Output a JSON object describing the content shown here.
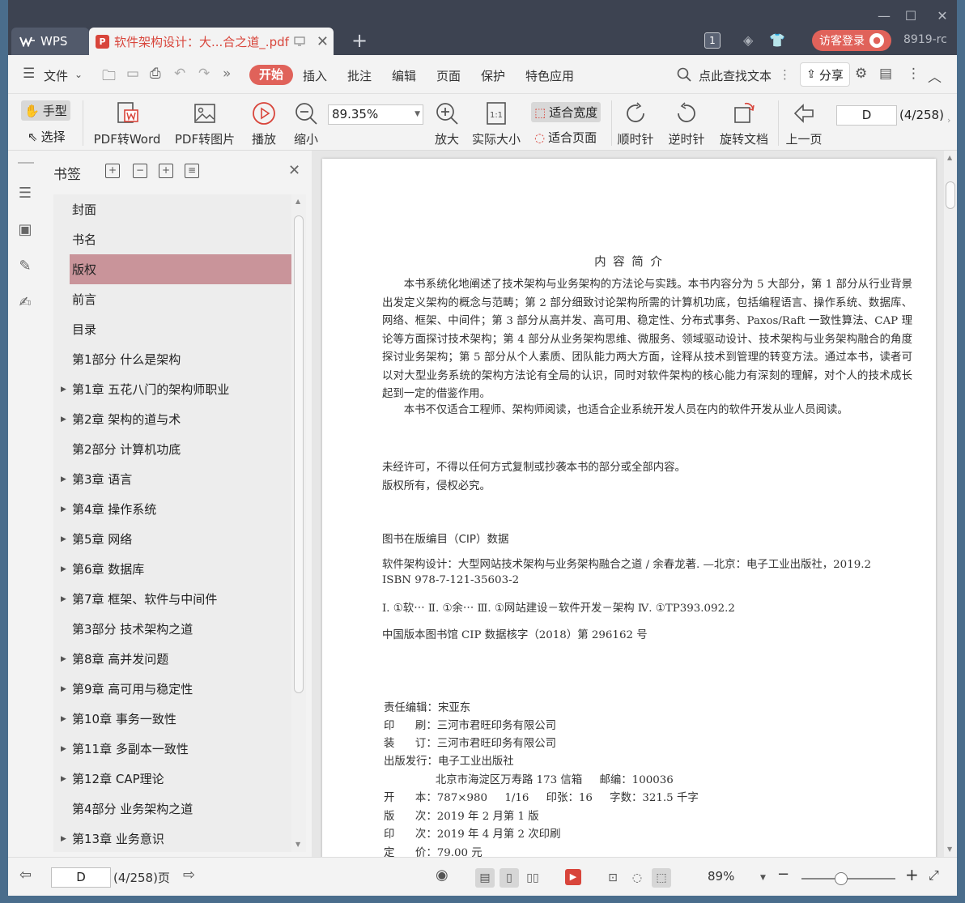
{
  "window": {
    "controls": [
      "—",
      "☐",
      "✕"
    ]
  },
  "tabs": {
    "home_label": "WPS",
    "doc_title": "软件架构设计：大...合之道_.pdf",
    "doc_badge": "1",
    "login_label": "访客登录",
    "user_name": "8919-rc"
  },
  "menu": {
    "file": "文件",
    "start": "开始",
    "insert": "插入",
    "annotate": "批注",
    "edit": "编辑",
    "page": "页面",
    "protect": "保护",
    "features": "特色应用",
    "search_hint": "点此查找文本",
    "share": "分享"
  },
  "ribbon": {
    "hand": "手型",
    "select": "选择",
    "pdf_to_word": "PDF转Word",
    "pdf_to_image": "PDF转图片",
    "play": "播放",
    "zoom_out": "缩小",
    "zoom_value": "89.35%",
    "zoom_in": "放大",
    "actual_size": "实际大小",
    "fit_width": "适合宽度",
    "fit_page": "适合页面",
    "rotate_cw": "顺时针",
    "rotate_ccw": "逆时针",
    "rotate_doc": "旋转文档",
    "prev_page": "上一页",
    "page_input": "D",
    "page_count": "(4/258)"
  },
  "bookmarks": {
    "title": "书签",
    "items": [
      {
        "label": "封面",
        "expandable": false,
        "selected": false
      },
      {
        "label": "书名",
        "expandable": false,
        "selected": false
      },
      {
        "label": "版权",
        "expandable": false,
        "selected": true
      },
      {
        "label": "前言",
        "expandable": false,
        "selected": false
      },
      {
        "label": "目录",
        "expandable": false,
        "selected": false
      },
      {
        "label": "第1部分  什么是架构",
        "expandable": false,
        "selected": false
      },
      {
        "label": "第1章  五花八门的架构师职业",
        "expandable": true,
        "selected": false
      },
      {
        "label": "第2章  架构的道与术",
        "expandable": true,
        "selected": false
      },
      {
        "label": "第2部分  计算机功底",
        "expandable": false,
        "selected": false
      },
      {
        "label": "第3章  语言",
        "expandable": true,
        "selected": false
      },
      {
        "label": "第4章  操作系统",
        "expandable": true,
        "selected": false
      },
      {
        "label": "第5章  网络",
        "expandable": true,
        "selected": false
      },
      {
        "label": "第6章  数据库",
        "expandable": true,
        "selected": false
      },
      {
        "label": "第7章  框架、软件与中间件",
        "expandable": true,
        "selected": false
      },
      {
        "label": "第3部分  技术架构之道",
        "expandable": false,
        "selected": false
      },
      {
        "label": "第8章  高并发问题",
        "expandable": true,
        "selected": false
      },
      {
        "label": "第9章  高可用与稳定性",
        "expandable": true,
        "selected": false
      },
      {
        "label": "第10章  事务一致性",
        "expandable": true,
        "selected": false
      },
      {
        "label": "第11章  多副本一致性",
        "expandable": true,
        "selected": false
      },
      {
        "label": "第12章  CAP理论",
        "expandable": true,
        "selected": false
      },
      {
        "label": "第4部分  业务架构之道",
        "expandable": false,
        "selected": false
      },
      {
        "label": "第13章  业务意识",
        "expandable": true,
        "selected": false
      }
    ]
  },
  "document": {
    "heading": "内 容 简 介",
    "intro": "本书系统化地阐述了技术架构与业务架构的方法论与实践。本书内容分为 5 大部分，第 1 部分从行业背景出发定义架构的概念与范畴；第 2 部分细致讨论架构所需的计算机功底，包括编程语言、操作系统、数据库、网络、框架、中间件；第 3 部分从高并发、高可用、稳定性、分布式事务、Paxos/Raft 一致性算法、CAP 理论等方面探讨技术架构；第 4 部分从业务架构思维、微服务、领域驱动设计、技术架构与业务架构融合的角度探讨业务架构；第 5 部分从个人素质、团队能力两大方面，诠释从技术到管理的转变方法。通过本书，读者可以对大型业务系统的架构方法论有全局的认识，同时对软件架构的核心能力有深刻的理解，对个人的技术成长起到一定的借鉴作用。",
    "audience": "本书不仅适合工程师、架构师阅读，也适合企业系统开发人员在内的软件开发从业人员阅读。",
    "rights1": "未经许可，不得以任何方式复制或抄袭本书的部分或全部内容。",
    "rights2": "版权所有，侵权必究。",
    "cip_title": "图书在版编目（CIP）数据",
    "cip_line1": "软件架构设计：大型网站技术架构与业务架构融合之道 / 余春龙著. —北京：电子工业出版社，2019.2",
    "cip_line2": "ISBN 978-7-121-35603-2",
    "cip_line3": "Ⅰ. ①软⋯  Ⅱ. ①余⋯  Ⅲ. ①网站建设－软件开发－架构  Ⅳ. ①TP393.092.2",
    "cip_line4": "中国版本图书馆 CIP 数据核字（2018）第 296162 号",
    "pub": [
      "责任编辑：宋亚东",
      "印      刷：三河市君旺印务有限公司",
      "装      订：三河市君旺印务有限公司",
      "出版发行：电子工业出版社",
      "               北京市海淀区万寿路 173 信箱     邮编：100036",
      "开      本：787×980     1/16     印张：16     字数：321.5 千字",
      "版      次：2019 年 2 月第 1 版",
      "印      次：2019 年 4 月第 2 次印刷",
      "定      价：79.00 元"
    ]
  },
  "status": {
    "page_input": "D",
    "page_count": "(4/258)页",
    "zoom": "89%"
  }
}
